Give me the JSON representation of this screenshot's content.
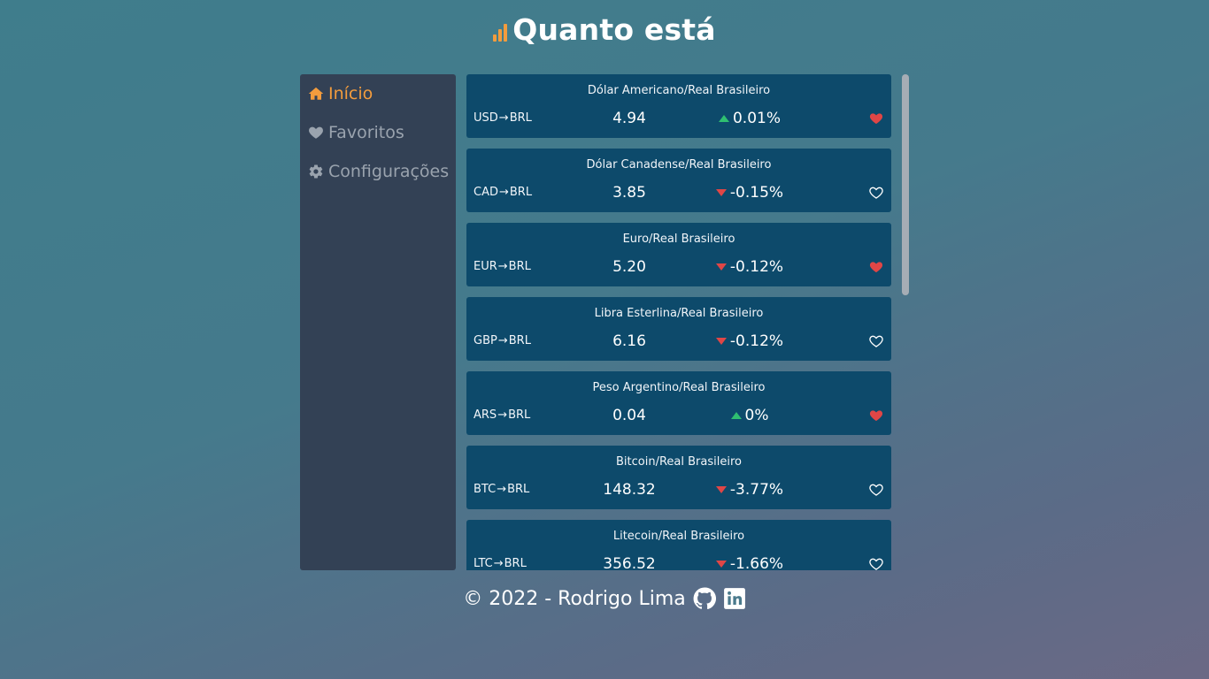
{
  "header": {
    "title": "Quanto está",
    "logo_icon": "bar-chart-icon"
  },
  "sidebar": {
    "items": [
      {
        "label": "Início",
        "icon": "home-icon",
        "active": true
      },
      {
        "label": "Favoritos",
        "icon": "heart-icon",
        "active": false
      },
      {
        "label": "Configurações",
        "icon": "gear-icon",
        "active": false
      }
    ]
  },
  "quotes": [
    {
      "name": "Dólar Americano/Real Brasileiro",
      "from": "USD",
      "to": "BRL",
      "value": "4.94",
      "change": "0.01%",
      "direction": "up",
      "favorite": true
    },
    {
      "name": "Dólar Canadense/Real Brasileiro",
      "from": "CAD",
      "to": "BRL",
      "value": "3.85",
      "change": "-0.15%",
      "direction": "down",
      "favorite": false
    },
    {
      "name": "Euro/Real Brasileiro",
      "from": "EUR",
      "to": "BRL",
      "value": "5.20",
      "change": "-0.12%",
      "direction": "down",
      "favorite": true
    },
    {
      "name": "Libra Esterlina/Real Brasileiro",
      "from": "GBP",
      "to": "BRL",
      "value": "6.16",
      "change": "-0.12%",
      "direction": "down",
      "favorite": false
    },
    {
      "name": "Peso Argentino/Real Brasileiro",
      "from": "ARS",
      "to": "BRL",
      "value": "0.04",
      "change": "0%",
      "direction": "up",
      "favorite": true
    },
    {
      "name": "Bitcoin/Real Brasileiro",
      "from": "BTC",
      "to": "BRL",
      "value": "148.32",
      "change": "-3.77%",
      "direction": "down",
      "favorite": false
    },
    {
      "name": "Litecoin/Real Brasileiro",
      "from": "LTC",
      "to": "BRL",
      "value": "356.52",
      "change": "-1.66%",
      "direction": "down",
      "favorite": false
    }
  ],
  "footer": {
    "text": "© 2022 - Rodrigo Lima",
    "icons": [
      "github-icon",
      "linkedin-icon"
    ]
  },
  "colors": {
    "accent": "#f39c3d",
    "up": "#2fbf71",
    "down": "#e04646",
    "favorite": "#e04646",
    "card": "#0d4a6b",
    "sidebar": "#334155"
  }
}
